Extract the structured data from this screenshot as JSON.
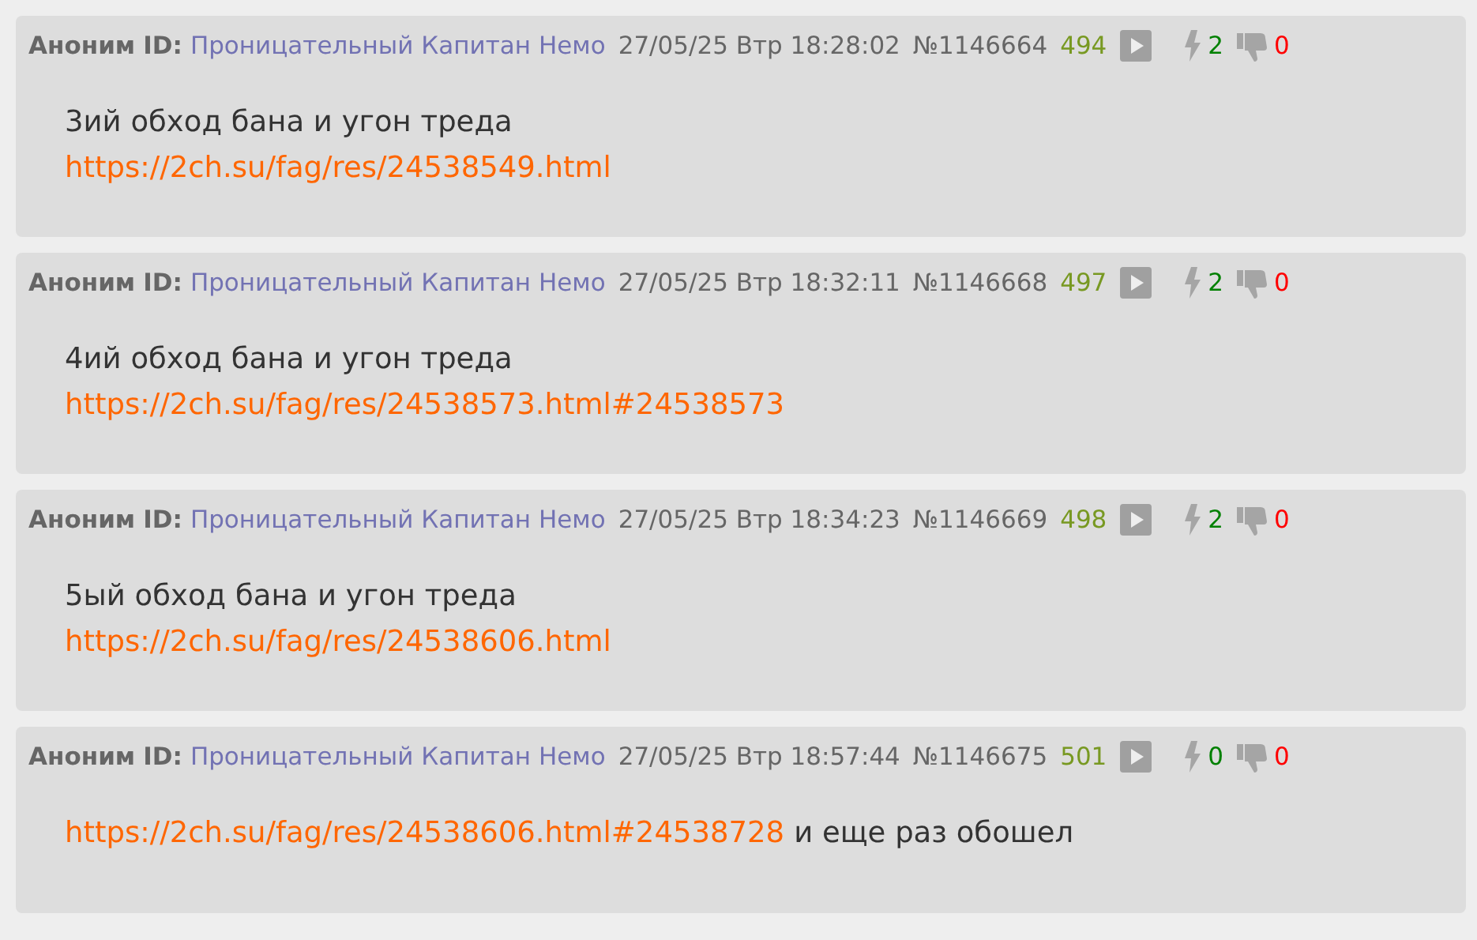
{
  "posts": [
    {
      "author": "Аноним",
      "id_label": "ID:",
      "id_name": "Проницательный Капитан Немо",
      "date": "27/05/25 Втр 18:28:02",
      "number": "№1146664",
      "index": "494",
      "likes": "2",
      "dislikes": "0",
      "lines": [
        [
          {
            "kind": "text",
            "text": "3ий обход бана и угон треда"
          }
        ],
        [
          {
            "kind": "link",
            "text": "https://2ch.su/fag/res/24538549.html"
          }
        ]
      ]
    },
    {
      "author": "Аноним",
      "id_label": "ID:",
      "id_name": "Проницательный Капитан Немо",
      "date": "27/05/25 Втр 18:32:11",
      "number": "№1146668",
      "index": "497",
      "likes": "2",
      "dislikes": "0",
      "lines": [
        [
          {
            "kind": "text",
            "text": "4ий обход бана и угон треда"
          }
        ],
        [
          {
            "kind": "link",
            "text": "https://2ch.su/fag/res/24538573.html#24538573"
          }
        ]
      ]
    },
    {
      "author": "Аноним",
      "id_label": "ID:",
      "id_name": "Проницательный Капитан Немо",
      "date": "27/05/25 Втр 18:34:23",
      "number": "№1146669",
      "index": "498",
      "likes": "2",
      "dislikes": "0",
      "lines": [
        [
          {
            "kind": "text",
            "text": "5ый обход бана и угон треда"
          }
        ],
        [
          {
            "kind": "link",
            "text": "https://2ch.su/fag/res/24538606.html"
          }
        ]
      ]
    },
    {
      "author": "Аноним",
      "id_label": "ID:",
      "id_name": "Проницательный Капитан Немо",
      "date": "27/05/25 Втр 18:57:44",
      "number": "№1146675",
      "index": "501",
      "likes": "0",
      "dislikes": "0",
      "lines": [
        [
          {
            "kind": "link",
            "text": "https://2ch.su/fag/res/24538606.html#24538728"
          },
          {
            "kind": "text",
            "text": "и еще раз обошел"
          }
        ]
      ]
    }
  ]
}
